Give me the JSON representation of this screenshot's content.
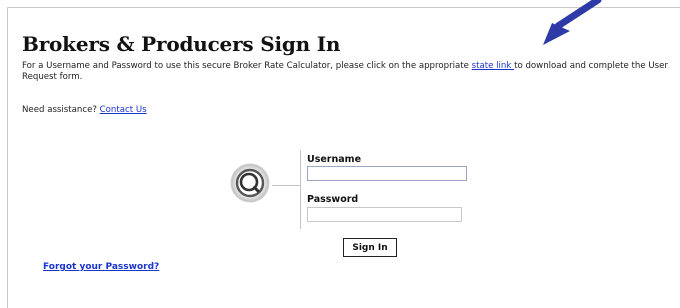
{
  "page": {
    "title": "Brokers & Producers Sign In",
    "intro_before_link": "For a Username and Password to use this secure Broker Rate Calculator, please click on the appropriate ",
    "state_link": "state link ",
    "intro_after_link": "to download and complete the User Request form.",
    "assist_label": "Need assistance? ",
    "contact_link": "Contact Us"
  },
  "login": {
    "username_label": "Username",
    "username_value": "",
    "password_label": "Password",
    "password_value": "",
    "signin_button": "Sign In",
    "forgot_link": "Forgot your Password?"
  },
  "icons": {
    "lens": "magnifier-icon",
    "annotation": "pointer-arrow-icon"
  },
  "colors": {
    "link": "#1a33cc",
    "arrow": "#2e3aa6",
    "input_border": "#9aa6c4"
  }
}
